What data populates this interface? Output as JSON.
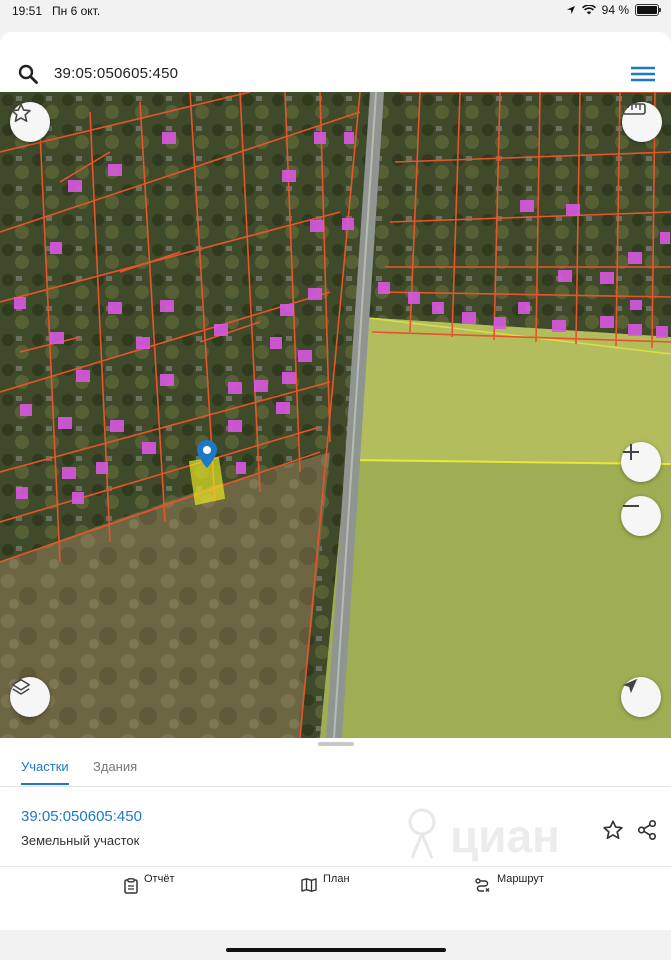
{
  "status_bar": {
    "time": "19:51",
    "date": "Пн 6 окт.",
    "battery": "94 %"
  },
  "search": {
    "value": "39:05:050605:450"
  },
  "icons": {
    "search": "search-icon",
    "menu": "hamburger-menu-icon",
    "favorite": "star-icon",
    "ruler": "ruler-icon",
    "zoom_in": "plus-icon",
    "zoom_out": "minus-icon",
    "layers": "layers-icon",
    "locate": "location-arrow-icon",
    "share": "share-icon"
  },
  "colors": {
    "accent": "#1e78c8",
    "parcel_border": "#e8542a",
    "selected_parcel": "#f2f21a",
    "building": "#d858e0"
  },
  "sheet": {
    "tabs": [
      {
        "label": "Участки",
        "active": true
      },
      {
        "label": "Здания",
        "active": false
      }
    ],
    "parcel": {
      "id": "39:05:050605:450",
      "type": "Земельный участок"
    },
    "watermark": "циан",
    "actions": [
      {
        "label": "Отчёт",
        "icon": "clipboard-icon"
      },
      {
        "label": "План",
        "icon": "map-icon"
      },
      {
        "label": "Маршрут",
        "icon": "route-icon"
      }
    ]
  }
}
